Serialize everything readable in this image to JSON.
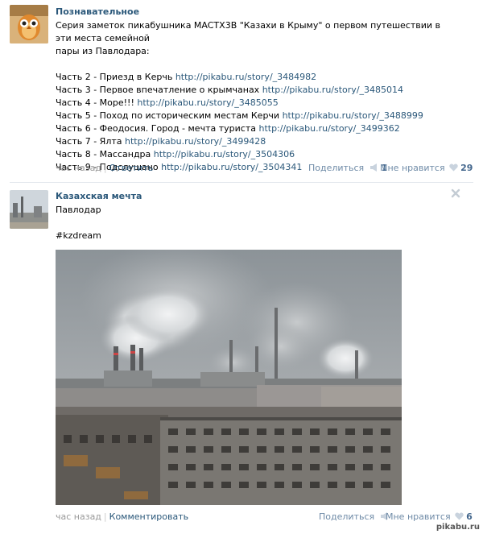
{
  "post1": {
    "author": "Познавательное",
    "intro_line1": "Серия заметок пикабушника MACTX3B \"Казахи в Крыму\" о первом путешествии в эти места семейной",
    "intro_line2": "пары из Павлодара:",
    "parts": [
      {
        "label": "Часть 2 - Приезд в Керчь",
        "url": "http://pikabu.ru/story/_3484982"
      },
      {
        "label": "Часть 3 - Первое впечатление о крымчанах",
        "url": "http://pikabu.ru/story/_3485014"
      },
      {
        "label": "Часть 4 - Море!!!",
        "url": "http://pikabu.ru/story/_3485055"
      },
      {
        "label": "Часть 5 - Поход по историческим местам Керчи",
        "url": "http://pikabu.ru/story/_3488999"
      },
      {
        "label": "Часть 6 - Феодосия. Город - мечта туриста",
        "url": "http://pikabu.ru/story/_3499362"
      },
      {
        "label": "Часть 7 - Ялта",
        "url": "http://pikabu.ru/story/_3499428"
      },
      {
        "label": "Часть 8 - Массандра",
        "url": "http://pikabu.ru/story/_3504306"
      },
      {
        "label": "Часть 9 - Подслушано",
        "url": "http://pikabu.ru/story/_3504341"
      }
    ],
    "time": "час назад",
    "action": "Ответить",
    "share_label": "Поделиться",
    "share_count": "1",
    "like_label": "Мне нравится",
    "like_count": "29"
  },
  "post2": {
    "author": "Казахская мечта",
    "text": "Павлодар",
    "hashtag": "#kzdream",
    "time": "час назад",
    "action": "Комментировать",
    "share_label": "Поделиться",
    "like_label": "Мне нравится",
    "like_count": "6"
  },
  "watermark": "pikabu.ru",
  "colors": {
    "link": "#2b587a",
    "muted": "#999999",
    "divider": "#e4e8ed"
  }
}
